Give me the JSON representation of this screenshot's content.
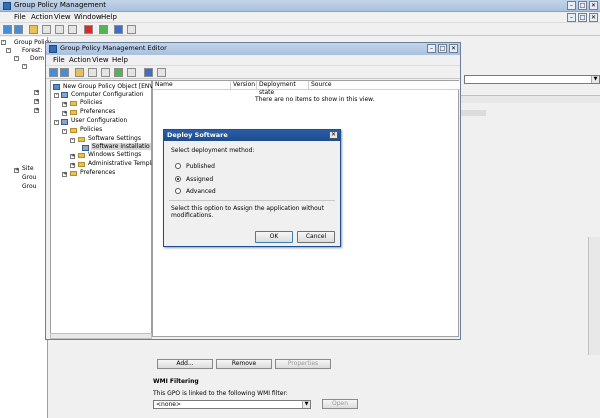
{
  "outer": {
    "title": "Group Policy Management",
    "menu": [
      "File",
      "Action",
      "View",
      "Window",
      "Help"
    ],
    "tree": [
      "Group Policy",
      "Forest:",
      "Dom",
      "Site",
      "Grou",
      "Grou"
    ],
    "buttons": {
      "add": "Add...",
      "remove": "Remove",
      "properties": "Properties"
    },
    "wmi": {
      "header": "WMI Filtering",
      "text": "This GPO is linked to the following WMI filter:",
      "selected": "<none>",
      "open": "Open"
    }
  },
  "editor": {
    "title": "Group Policy Management Editor",
    "menu": [
      "File",
      "Action",
      "View",
      "Help"
    ],
    "tree": {
      "root": "New Group Policy Object [ENV43-D",
      "computer": "Computer Configuration",
      "c_policies": "Policies",
      "c_prefs": "Preferences",
      "user": "User Configuration",
      "u_policies": "Policies",
      "software_settings": "Software Settings",
      "software_install": "Software installatio",
      "windows_settings": "Windows Settings",
      "admin_templates": "Administrative Templat",
      "u_prefs": "Preferences"
    },
    "columns": [
      "Name",
      "Version",
      "Deployment state",
      "Source"
    ],
    "empty_message": "There are no items to show in this view."
  },
  "dialog": {
    "title": "Deploy Software",
    "prompt": "Select deployment method:",
    "options": [
      "Published",
      "Assigned",
      "Advanced"
    ],
    "selected": "Assigned",
    "description": "Select this option to Assign the application without modifications.",
    "ok": "OK",
    "cancel": "Cancel"
  }
}
